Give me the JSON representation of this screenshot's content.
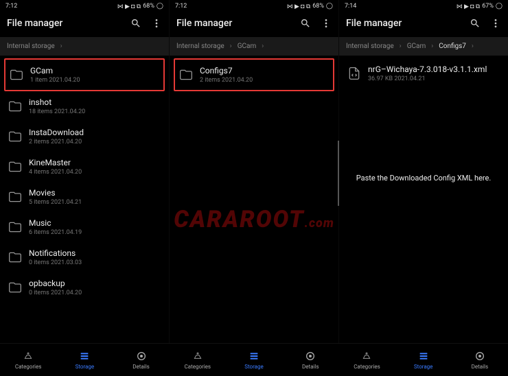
{
  "panels": [
    {
      "status": {
        "time": "7:12",
        "battery": "68%",
        "icons": "⋈ ▶ ◘ ⧉"
      },
      "title": "File manager",
      "breadcrumb": [
        {
          "label": "Internal storage",
          "active": false
        }
      ],
      "rows": [
        {
          "icon": "folder",
          "name": "GCam",
          "meta": "1 item   2021.04.20",
          "highlight": true
        },
        {
          "icon": "folder",
          "name": "inshot",
          "meta": "18 items   2021.04.20"
        },
        {
          "icon": "folder",
          "name": "InstaDownload",
          "meta": "2 items   2021.04.20"
        },
        {
          "icon": "folder",
          "name": "KineMaster",
          "meta": "4 items   2021.04.20"
        },
        {
          "icon": "folder",
          "name": "Movies",
          "meta": "5 items   2021.04.21"
        },
        {
          "icon": "folder",
          "name": "Music",
          "meta": "6 items   2021.04.19"
        },
        {
          "icon": "folder",
          "name": "Notifications",
          "meta": "0 items   2021.03.03"
        },
        {
          "icon": "folder",
          "name": "opbackup",
          "meta": "0 items   2021.04.20"
        }
      ]
    },
    {
      "status": {
        "time": "7:12",
        "battery": "68%",
        "icons": "⋈ ▶ ◘ ⧉"
      },
      "title": "File manager",
      "breadcrumb": [
        {
          "label": "Internal storage",
          "active": false
        },
        {
          "label": "GCam",
          "active": false
        }
      ],
      "rows": [
        {
          "icon": "folder",
          "name": "Configs7",
          "meta": "2 items   2021.04.20",
          "highlight": true
        }
      ],
      "scrollhint": true
    },
    {
      "status": {
        "time": "7:14",
        "battery": "67%",
        "icons": "⋈ ▶ ◘ ⧉"
      },
      "title": "File manager",
      "breadcrumb": [
        {
          "label": "Internal storage",
          "active": false
        },
        {
          "label": "GCam",
          "active": false
        },
        {
          "label": "Configs7",
          "active": true
        }
      ],
      "rows": [
        {
          "icon": "xml",
          "name": "nrG–Wichaya-7.3.018-v3.1.1.xml",
          "meta": "36.97 KB   2021.04.21"
        }
      ],
      "instruction": "Paste the Downloaded Config XML here."
    }
  ],
  "nav": [
    {
      "icon": "categories",
      "label": "Categories"
    },
    {
      "icon": "storage",
      "label": "Storage",
      "active": true
    },
    {
      "icon": "details",
      "label": "Details"
    }
  ],
  "watermark": {
    "big": "CARAROOT",
    "small": ".com"
  }
}
